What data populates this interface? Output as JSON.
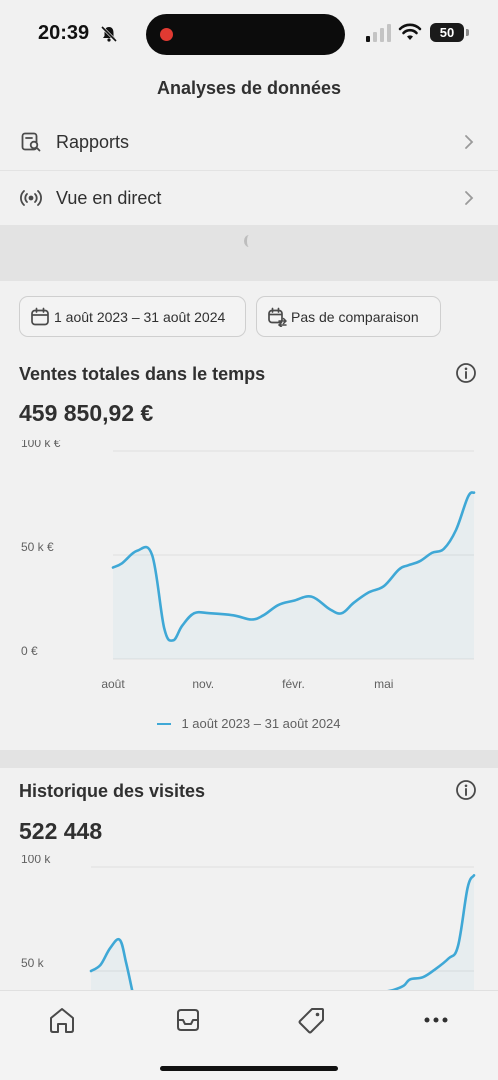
{
  "status_bar": {
    "time": "20:39",
    "battery": "50"
  },
  "header": {
    "title": "Analyses de données"
  },
  "menu": [
    {
      "label": "Rapports",
      "icon": "report-search-icon"
    },
    {
      "label": "Vue en direct",
      "icon": "live-broadcast-icon"
    }
  ],
  "filters": {
    "date_range": "1 août 2023 – 31 août 2024",
    "comparison": "Pas de comparaison"
  },
  "sales_card": {
    "title": "Ventes totales dans le temps",
    "value": "459 850,92 €",
    "legend": "1 août 2023 – 31 août 2024"
  },
  "visits_card": {
    "title": "Historique des visites",
    "value": "522 448"
  },
  "chart_data": [
    {
      "type": "line",
      "title": "Ventes totales dans le temps",
      "y_tick_labels": [
        "100 k €",
        "50 k €",
        "0 €"
      ],
      "y_ticks": [
        100000,
        50000,
        0
      ],
      "ylim": [
        0,
        100000
      ],
      "x_tick_labels": [
        "août",
        "nov.",
        "févr.",
        "mai"
      ],
      "x_tick_positions": [
        0,
        3,
        6,
        9
      ],
      "x_range": [
        0,
        12
      ],
      "color": "#3fa8d6",
      "series": [
        {
          "name": "1 août 2023 – 31 août 2024",
          "x": [
            0,
            0.3,
            0.8,
            1.3,
            1.7,
            2.0,
            2.3,
            2.7,
            3.2,
            4.0,
            4.6,
            5.0,
            5.5,
            6.0,
            6.6,
            7.2,
            7.6,
            8.0,
            8.5,
            9.0,
            9.5,
            9.8,
            10.2,
            10.6,
            11.0,
            11.4,
            11.8,
            12.0
          ],
          "values": [
            44000,
            46000,
            52000,
            50000,
            15000,
            9000,
            16000,
            22000,
            22000,
            21000,
            19000,
            21000,
            26000,
            28000,
            30000,
            24000,
            22000,
            27000,
            32000,
            35000,
            43000,
            45000,
            47000,
            51000,
            53000,
            62000,
            78000,
            80000
          ]
        }
      ],
      "grid": true
    },
    {
      "type": "line",
      "title": "Historique des visites",
      "y_tick_labels": [
        "100 k",
        "50 k"
      ],
      "y_ticks": [
        100000,
        50000
      ],
      "ylim": [
        0,
        100000
      ],
      "x_range": [
        0,
        12
      ],
      "color": "#3fa8d6",
      "series": [
        {
          "name": "",
          "x": [
            0,
            0.3,
            0.6,
            0.9,
            1.1,
            1.3,
            9.2,
            9.5,
            9.8,
            10.0,
            10.4,
            10.8,
            11.2,
            11.5,
            11.8,
            12.0
          ],
          "values": [
            50000,
            53000,
            61000,
            65000,
            54000,
            40000,
            40000,
            41000,
            43000,
            46000,
            47000,
            51000,
            56000,
            62000,
            90000,
            96000
          ]
        }
      ],
      "grid": true
    }
  ],
  "tab_bar": [
    "home-icon",
    "inbox-icon",
    "tag-icon",
    "more-icon"
  ]
}
